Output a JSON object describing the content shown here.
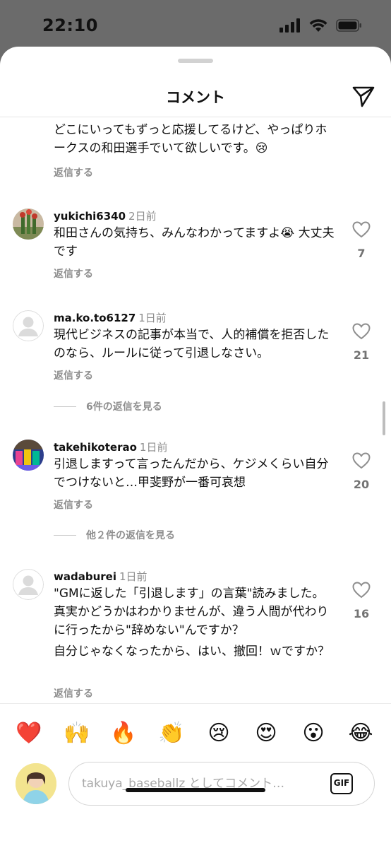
{
  "status_bar": {
    "time": "22:10"
  },
  "sheet": {
    "title": "コメント"
  },
  "comments": [
    {
      "user": "",
      "time": "",
      "lines": [
        "どこにいってもずっと応援してるけど、やっぱりホークスの和田選手でいて欲しいです。😢"
      ],
      "reply_label": "返信する"
    },
    {
      "user": "yukichi6340",
      "time": "2日前",
      "lines": [
        "和田さんの気持ち、みんなわかってますよ😭 大丈夫です"
      ],
      "reply_label": "返信する",
      "likes": "7"
    },
    {
      "user": "ma.ko.to6127",
      "time": "1日前",
      "lines": [
        "現代ビジネスの記事が本当で、人的補償を拒否したのなら、ルールに従って引退しなさい。"
      ],
      "reply_label": "返信する",
      "likes": "21",
      "view_replies": "6件の返信を見る"
    },
    {
      "user": "takehikoterao",
      "time": "1日前",
      "lines": [
        "引退しますって言ったんだから、ケジメくらい自分でつけないと…甲斐野が一番可哀想"
      ],
      "reply_label": "返信する",
      "likes": "20",
      "view_replies": "他２件の返信を見る"
    },
    {
      "user": "wadaburei",
      "time": "1日前",
      "lines": [
        "\"GMに返した「引退します」の言葉\"読みました。真実かどうかはわかりませんが、違う人間が代わりに行ったから\"辞めない\"んですか？",
        "自分じゃなくなったから、はい、撤回！ｗですか？"
      ],
      "reply_label": "返信する",
      "likes": "16"
    }
  ],
  "reactions": [
    "❤️",
    "🙌",
    "🔥",
    "👏",
    "😢",
    "😍",
    "😮",
    "😂"
  ],
  "compose": {
    "placeholder": "takuya_baseballz としてコメント…",
    "gif_label": "GIF"
  }
}
